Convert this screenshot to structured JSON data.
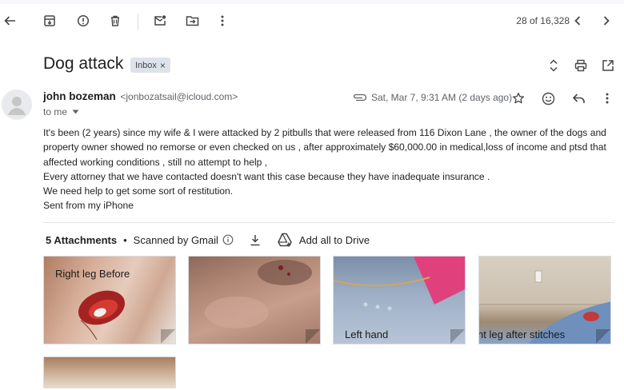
{
  "toolbar": {
    "counter": "28 of 16,328"
  },
  "email": {
    "subject": "Dog attack",
    "label": "Inbox",
    "label_remove": "×",
    "sender_name": "john bozeman",
    "sender_email": "<jonbozatsail@icloud.com>",
    "to": "to me",
    "date": "Sat, Mar 7, 9:31 AM (2 days ago)",
    "body": [
      "It's been (2 years) since my wife & I were attacked by 2 pitbulls that were  released from 116 Dixon Lane , the owner of the dogs and property owner showed no remorse or even checked on us , after approximately $60,000.00 in medical,loss of income and ptsd that affected working conditions , still no attempt to help ,",
      "Every attorney that we have contacted doesn't want this case because they have inadequate insurance .",
      "We need help to get some sort of restitution.",
      "Sent from my iPhone"
    ]
  },
  "attachments": {
    "count_label": "5 Attachments",
    "separator": "•",
    "scanned_label": "Scanned by Gmail",
    "drive_label": "Add all to Drive",
    "items": [
      {
        "overlay": "Right leg Before"
      },
      {
        "overlay": ""
      },
      {
        "overlay": "Left hand"
      },
      {
        "overlay": "nt leg after stitches"
      },
      {
        "overlay": ""
      }
    ]
  },
  "icons": {
    "back": "arrow-left-icon",
    "archive": "archive-icon",
    "spam": "report-spam-icon",
    "delete": "trash-icon",
    "mark_unread": "mark-unread-icon",
    "move": "move-to-icon",
    "more": "more-vert-icon",
    "prev": "chevron-left-icon",
    "next": "chevron-right-icon"
  }
}
